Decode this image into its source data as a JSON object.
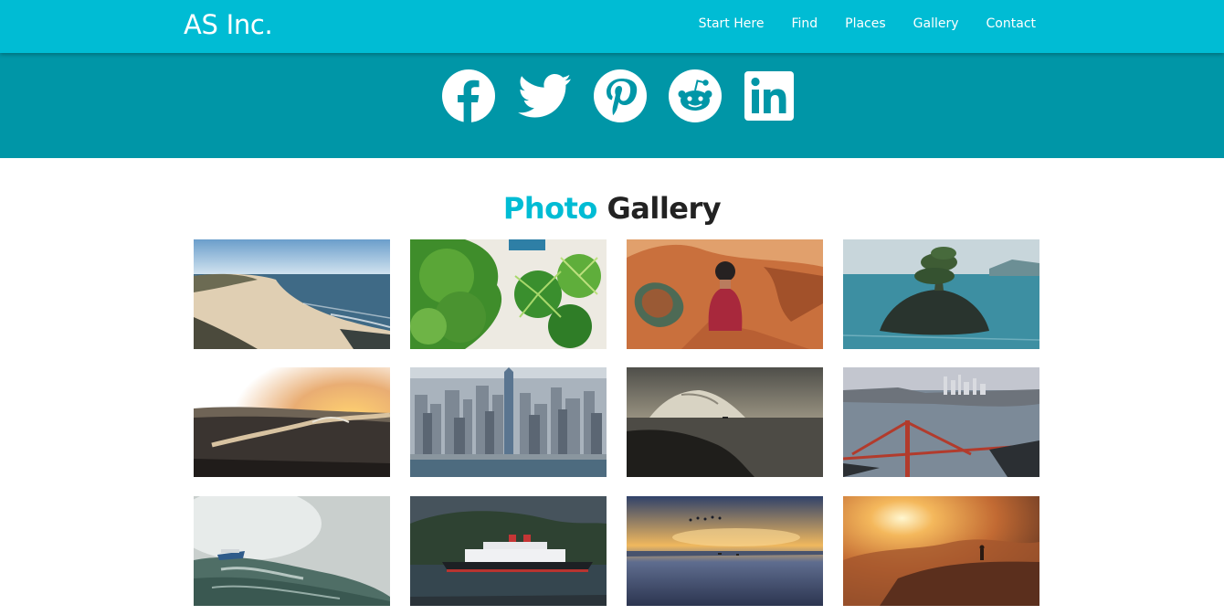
{
  "header": {
    "brand": "AS Inc.",
    "nav": [
      "Start Here",
      "Find",
      "Places",
      "Gallery",
      "Contact"
    ]
  },
  "social": {
    "icons": [
      "facebook-icon",
      "twitter-icon",
      "pinterest-icon",
      "reddit-icon",
      "linkedin-icon"
    ]
  },
  "gallery": {
    "title_accent": "Photo",
    "title_main": "Gallery"
  },
  "colors": {
    "navbar": "#00bcd4",
    "social_band": "#0096a7",
    "title_accent": "#00bcd4"
  }
}
